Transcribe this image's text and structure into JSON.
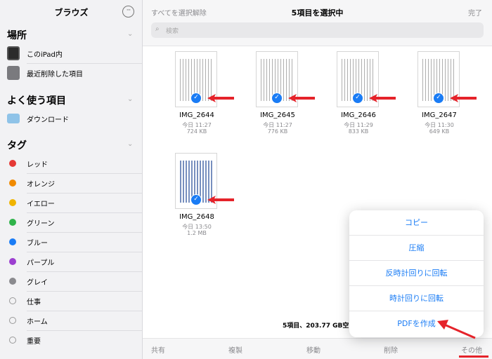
{
  "sidebar": {
    "title": "ブラウズ",
    "more_glyph": "···",
    "locations_heading": "場所",
    "locations": [
      {
        "label": "このiPad内",
        "icon": "ipad-icon"
      },
      {
        "label": "最近削除した項目",
        "icon": "trash-icon"
      }
    ],
    "favorites_heading": "よく使う項目",
    "favorites": [
      {
        "label": "ダウンロード",
        "icon": "folder-icon"
      }
    ],
    "tags_heading": "タグ",
    "tags": [
      {
        "label": "レッド",
        "color": "#e53935"
      },
      {
        "label": "オレンジ",
        "color": "#f08a00"
      },
      {
        "label": "イエロー",
        "color": "#f0b400"
      },
      {
        "label": "グリーン",
        "color": "#2fb34a"
      },
      {
        "label": "ブルー",
        "color": "#1a7cf5"
      },
      {
        "label": "パープル",
        "color": "#9c3fd0"
      },
      {
        "label": "グレイ",
        "color": "#8a8a8e"
      },
      {
        "label": "仕事",
        "color": ""
      },
      {
        "label": "ホーム",
        "color": ""
      },
      {
        "label": "重要",
        "color": ""
      }
    ]
  },
  "topbar": {
    "deselect_all": "すべてを選択解除",
    "title": "5項目を選択中",
    "done": "完了",
    "search_placeholder": "検索"
  },
  "files": [
    {
      "name": "IMG_2644",
      "date": "今日 11:27",
      "size": "724 KB"
    },
    {
      "name": "IMG_2645",
      "date": "今日 11:27",
      "size": "776 KB"
    },
    {
      "name": "IMG_2646",
      "date": "今日 11:29",
      "size": "833 KB"
    },
    {
      "name": "IMG_2647",
      "date": "今日 11:30",
      "size": "649 KB"
    },
    {
      "name": "IMG_2648",
      "date": "今日 13:50",
      "size": "1.2 MB"
    }
  ],
  "status_text": "5項目、203.77 GB空き",
  "toolbar": {
    "share": "共有",
    "duplicate": "複製",
    "move": "移動",
    "delete": "削除",
    "more": "その他"
  },
  "menu": {
    "items": [
      "コピー",
      "圧縮",
      "反時計回りに回転",
      "時計回りに回転",
      "PDFを作成"
    ]
  },
  "colors": {
    "accent": "#1a7cf5",
    "annotation_red": "#e5232a"
  }
}
